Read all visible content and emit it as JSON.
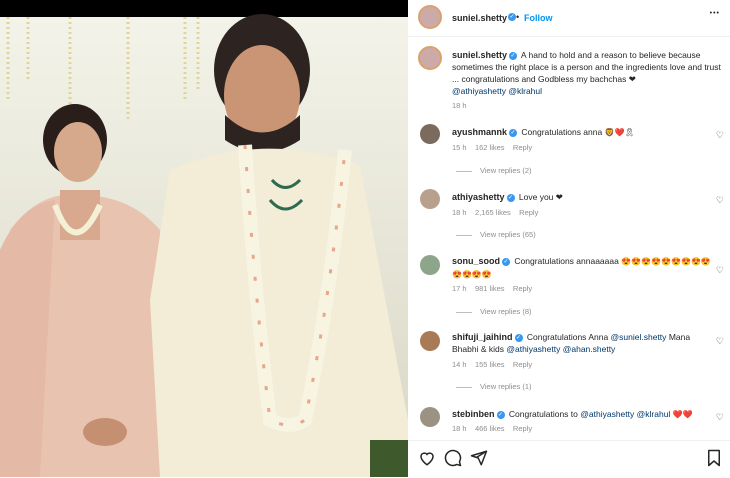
{
  "header": {
    "username": "suniel.shetty",
    "follow_label": "Follow",
    "more_icon": "•••"
  },
  "caption": {
    "username": "suniel.shetty",
    "text": "A hand to hold and a reason to believe because sometimes the right place is a person and the ingredients love and trust ... congratulations and Godbless my bachchas",
    "heart": "❤",
    "mentions": "@athiyashetty @klrahul",
    "time": "18 h"
  },
  "comments": [
    {
      "username": "ayushmannk",
      "text": "Congratulations anna",
      "emoji": "🦁❤️🎗",
      "time": "15 h",
      "likes": "162 likes",
      "reply": "Reply",
      "view_replies": "View replies (2)"
    },
    {
      "username": "athiyashetty",
      "text": "Love you ❤",
      "emoji": "",
      "time": "18 h",
      "likes": "2,165 likes",
      "reply": "Reply",
      "view_replies": "View replies (65)"
    },
    {
      "username": "sonu_sood",
      "text": "Congratulations annaaaaaa",
      "emoji": "😍😍😍😍😍😍😍😍😍😍😍😍😍",
      "time": "17 h",
      "likes": "981 likes",
      "reply": "Reply",
      "view_replies": "View replies (8)"
    },
    {
      "username": "shifuji_jaihind",
      "text": "Congratulations Anna",
      "mention1": "@suniel.shetty",
      "text2": "Mana Bhabhi & kids",
      "mention2": "@athiyashetty",
      "mention3": "@ahan.shetty",
      "time": "14 h",
      "likes": "155 likes",
      "reply": "Reply",
      "view_replies": "View replies (1)"
    },
    {
      "username": "stebinben",
      "text": "Congratulations to",
      "mention1": "@athiyashetty",
      "mention2": "@klrahul",
      "emoji": "❤️❤️",
      "time": "18 h",
      "likes": "466 likes",
      "reply": "Reply"
    }
  ],
  "colors": {
    "accent": "#3897f0",
    "text": "#262626",
    "muted": "#8e8e8e",
    "link": "#00376b"
  }
}
